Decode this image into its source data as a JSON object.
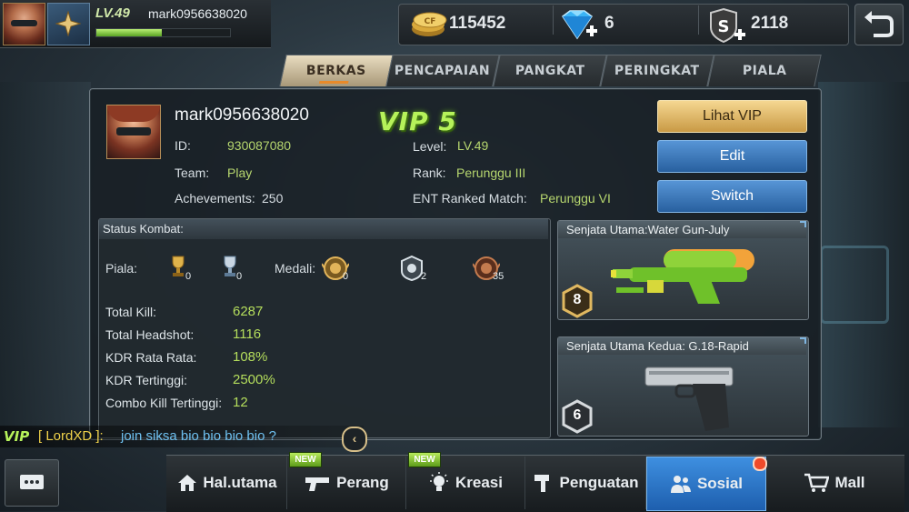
{
  "player": {
    "level": "LV.49",
    "username": "mark0956638020",
    "xp_fraction": 0.49
  },
  "currency": {
    "coins": "115452",
    "diamonds": "6",
    "s_points": "2118"
  },
  "tabs": [
    {
      "label": "BERKAS",
      "active": true
    },
    {
      "label": "PENCAPAIAN",
      "active": false
    },
    {
      "label": "PANGKAT",
      "active": false
    },
    {
      "label": "PERINGKAT",
      "active": false
    },
    {
      "label": "PIALA",
      "active": false
    }
  ],
  "profile": {
    "name": "mark0956638020",
    "vip": "VIP 5",
    "id_label": "ID:",
    "id_value": "930087080",
    "team_label": "Team:",
    "team_value": "Play",
    "achievements_label": "Achevements:",
    "achievements_value": "250",
    "level_label": "Level:",
    "level_value": "LV.49",
    "rank_label": "Rank:",
    "rank_value": "Perunggu III",
    "ranked_label": "ENT Ranked Match:",
    "ranked_value": "Perunggu VI"
  },
  "actions": {
    "vip_button": "Lihat VIP",
    "edit_button": "Edit",
    "switch_button": "Switch"
  },
  "combat": {
    "title": "Status Kombat:",
    "piala_label": "Piala:",
    "piala_gold": "0",
    "piala_silver": "0",
    "medali_label": "Medali:",
    "medal_1": "0",
    "medal_2": "2",
    "medal_3": "35",
    "stats": [
      {
        "label": "Total Kill:",
        "value": "6287"
      },
      {
        "label": "Total Headshot:",
        "value": "1116"
      },
      {
        "label": "KDR Rata Rata:",
        "value": "108%"
      },
      {
        "label": "KDR Tertinggi:",
        "value": "2500%"
      },
      {
        "label": "Combo Kill Tertinggi:",
        "value": "12"
      }
    ]
  },
  "weapons": {
    "primary_title": "Senjata Utama:Water Gun-July",
    "primary_level": "8",
    "secondary_title": "Senjata Utama Kedua: G.18-Rapid",
    "secondary_level": "6"
  },
  "chat": {
    "vip": "VIP",
    "sender": "[ LordXD ]:",
    "message": "join siksa bio bio bio bio ?"
  },
  "nav": {
    "items": [
      {
        "label": "Hal.utama",
        "icon": "house-icon"
      },
      {
        "label": "Perang",
        "icon": "gun-icon",
        "badge": "NEW"
      },
      {
        "label": "Kreasi",
        "icon": "bulb-icon",
        "badge": "NEW"
      },
      {
        "label": "Penguatan",
        "icon": "hammer-icon"
      },
      {
        "label": "Sosial",
        "icon": "people-icon",
        "active": true
      },
      {
        "label": "Mall",
        "icon": "cart-icon"
      }
    ]
  },
  "colors": {
    "accent_green": "#b6f25a",
    "accent_blue": "#3e8fe0",
    "accent_gold": "#f5d791"
  }
}
